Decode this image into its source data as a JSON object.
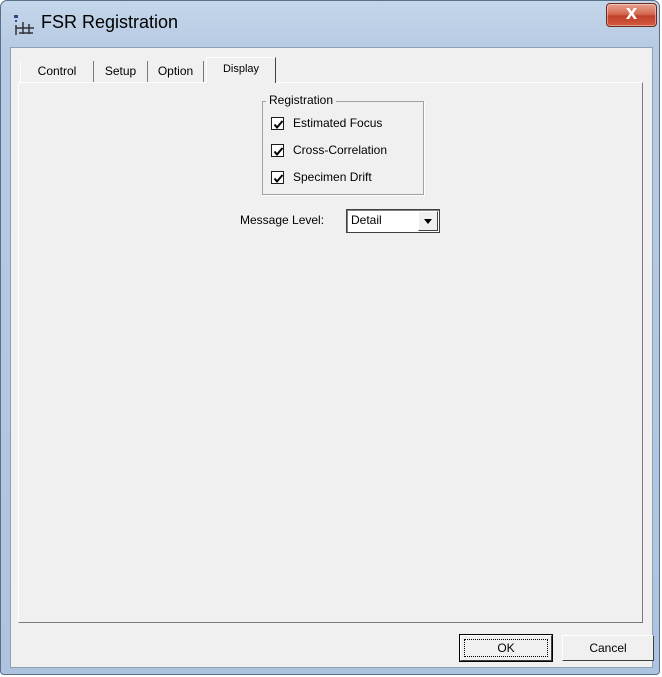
{
  "window": {
    "title": "FSR Registration",
    "close_glyph": "X",
    "app_icon": "fsr-app-icon"
  },
  "tabs": [
    {
      "label": "Control",
      "active": false
    },
    {
      "label": "Setup",
      "active": false
    },
    {
      "label": "Option",
      "active": false
    },
    {
      "label": "Display",
      "active": true
    }
  ],
  "registration": {
    "title": "Registration",
    "options": [
      {
        "label": "Estimated Focus",
        "checked": true
      },
      {
        "label": "Cross-Correlation",
        "checked": true
      },
      {
        "label": "Specimen Drift",
        "checked": true
      }
    ]
  },
  "message_level": {
    "label": "Message Level:",
    "value": "Detail"
  },
  "buttons": {
    "ok": "OK",
    "cancel": "Cancel"
  },
  "colors": {
    "chrome": "#b7cbe3",
    "close": "#c0412a",
    "face": "#f0f0f0"
  }
}
